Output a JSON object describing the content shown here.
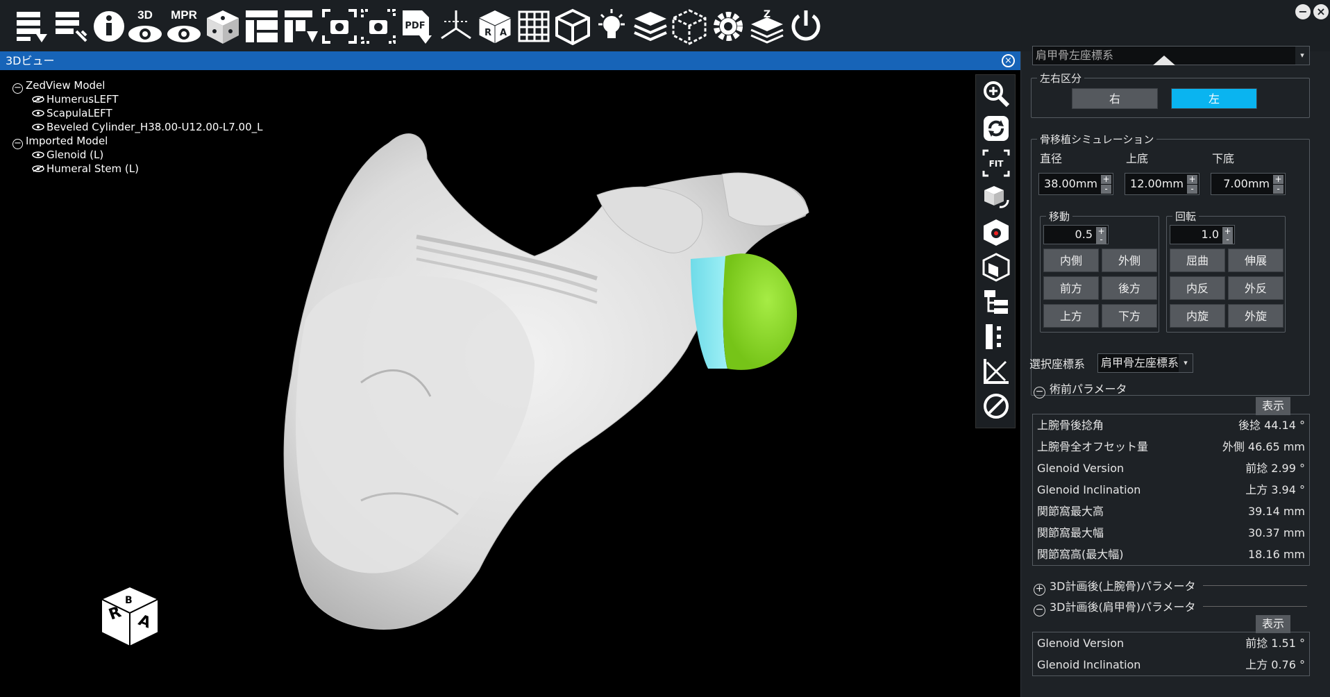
{
  "toolbar": {
    "items": [
      {
        "name": "import-data-icon",
        "label": ""
      },
      {
        "name": "export-data-icon",
        "label": ""
      },
      {
        "name": "info-icon",
        "label": ""
      },
      {
        "name": "3d-view-icon",
        "label": "3D"
      },
      {
        "name": "mpr-view-icon",
        "label": "MPR"
      },
      {
        "name": "dice-cube-icon",
        "label": ""
      },
      {
        "name": "layout-icon",
        "label": ""
      },
      {
        "name": "layout-export-icon",
        "label": ""
      },
      {
        "name": "screenshot-icon",
        "label": ""
      },
      {
        "name": "multi-screenshot-icon",
        "label": ""
      },
      {
        "name": "pdf-export-icon",
        "label": ""
      },
      {
        "name": "axes-icon",
        "label": ""
      },
      {
        "name": "orientation-cube-icon",
        "label": ""
      },
      {
        "name": "grid-icon",
        "label": ""
      },
      {
        "name": "wireframe-cube-icon",
        "label": ""
      },
      {
        "name": "lightbulb-icon",
        "label": ""
      },
      {
        "name": "layers-stack-icon",
        "label": ""
      },
      {
        "name": "dashed-cube-icon",
        "label": ""
      },
      {
        "name": "settings-gear-icon",
        "label": ""
      },
      {
        "name": "zedview-layers-icon",
        "label": ""
      },
      {
        "name": "power-icon",
        "label": ""
      }
    ],
    "minimize": "−",
    "close": "×"
  },
  "view": {
    "title": "3Dビュー",
    "close": "×"
  },
  "tree": {
    "root1": "ZedView Model",
    "root1_children": [
      "HumerusLEFT",
      "ScapulaLEFT",
      "Beveled Cylinder_H38.00-U12.00-L7.00_L"
    ],
    "root2": "Imported Model",
    "root2_children": [
      "Glenoid (L)",
      "Humeral Stem (L)"
    ]
  },
  "orientation_cube": {
    "r": "R",
    "a": "A",
    "b": "B"
  },
  "panel": {
    "coord_top_text": "肩甲骨左座標系",
    "side": {
      "title": "左右区分",
      "right": "右",
      "left": "左",
      "active": "left"
    },
    "bone_graft": {
      "title": "骨移植シミュレーション",
      "diameter_label": "直径",
      "upper_label": "上底",
      "lower_label": "下底",
      "diameter": "38.00mm",
      "upper": "12.00mm",
      "lower": "7.00mm"
    },
    "move": {
      "title": "移動",
      "step": "0.5",
      "buttons": [
        "内側",
        "外側",
        "前方",
        "後方",
        "上方",
        "下方"
      ]
    },
    "rotate": {
      "title": "回転",
      "step": "1.0",
      "buttons": [
        "屈曲",
        "伸展",
        "内反",
        "外反",
        "内旋",
        "外旋"
      ]
    },
    "coord_label": "選択座標系",
    "coord_value": "肩甲骨左座標系",
    "preop": {
      "title": "術前パラメータ",
      "show": "表示",
      "rows": [
        {
          "k": "上腕骨後捻角",
          "v": "後捻 44.14 °"
        },
        {
          "k": "上腕骨全オフセット量",
          "v": "外側 46.65 mm"
        },
        {
          "k": "Glenoid Version",
          "v": "前捻 2.99 °"
        },
        {
          "k": "Glenoid Inclination",
          "v": "上方 3.94 °"
        },
        {
          "k": "関節窩最大高",
          "v": "39.14 mm"
        },
        {
          "k": "関節窩最大幅",
          "v": "30.37 mm"
        },
        {
          "k": "関節窩高(最大幅)",
          "v": "18.16 mm"
        }
      ]
    },
    "post_humerus": {
      "title": "3D計画後(上腕骨)パラメータ"
    },
    "post_scapula": {
      "title": "3D計画後(肩甲骨)パラメータ",
      "show": "表示",
      "rows": [
        {
          "k": "Glenoid Version",
          "v": "前捻 1.51 °"
        },
        {
          "k": "Glenoid Inclination",
          "v": "上方 0.76 °"
        }
      ]
    }
  },
  "colors": {
    "accent_blue": "#1764b8",
    "active_button": "#0ab4f0",
    "sphere_green": "#8cd82a",
    "cylinder_cyan": "#7fe6f0"
  }
}
